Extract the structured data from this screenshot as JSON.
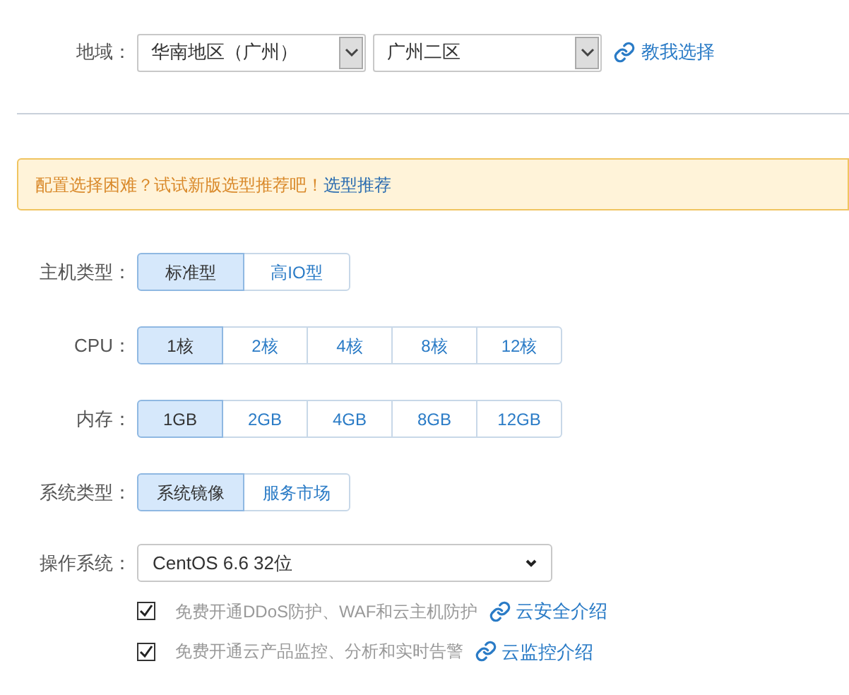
{
  "region": {
    "label": "地域：",
    "selects": [
      {
        "value": "华南地区（广州）"
      },
      {
        "value": "广州二区"
      }
    ],
    "help_link": "教我选择"
  },
  "notice": {
    "text": "配置选择困难？试试新版选型推荐吧！",
    "link": "选型推荐"
  },
  "options": [
    {
      "label": "主机类型：",
      "choices": [
        {
          "label": "标准型",
          "selected": true
        },
        {
          "label": "高IO型",
          "selected": false
        }
      ]
    },
    {
      "label": "CPU：",
      "choices": [
        {
          "label": "1核",
          "selected": true
        },
        {
          "label": "2核",
          "selected": false
        },
        {
          "label": "4核",
          "selected": false
        },
        {
          "label": "8核",
          "selected": false
        },
        {
          "label": "12核",
          "selected": false
        }
      ]
    },
    {
      "label": "内存：",
      "choices": [
        {
          "label": "1GB",
          "selected": true
        },
        {
          "label": "2GB",
          "selected": false
        },
        {
          "label": "4GB",
          "selected": false
        },
        {
          "label": "8GB",
          "selected": false
        },
        {
          "label": "12GB",
          "selected": false
        }
      ]
    },
    {
      "label": "系统类型：",
      "choices": [
        {
          "label": "系统镜像",
          "selected": true
        },
        {
          "label": "服务市场",
          "selected": false
        }
      ]
    }
  ],
  "os": {
    "label": "操作系统：",
    "value": "CentOS 6.6 32位"
  },
  "services": [
    {
      "label": "免费开通DDoS防护、WAF和云主机防护",
      "checked": true,
      "link": "云安全介绍"
    },
    {
      "label": "免费开通云产品监控、分析和实时告警",
      "checked": true,
      "link": "云监控介绍"
    }
  ]
}
